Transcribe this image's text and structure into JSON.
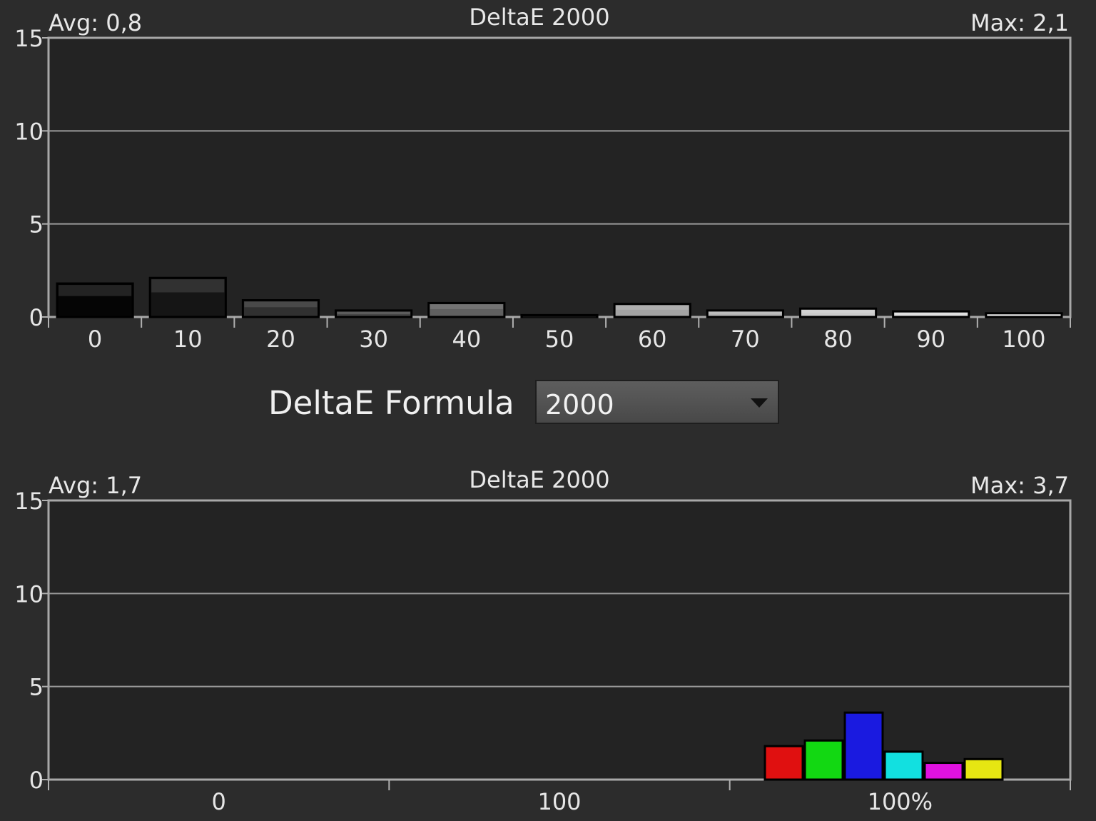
{
  "charts": [
    {
      "avg_label": "Avg: 0,8",
      "title": "DeltaE 2000",
      "max_label": "Max: 2,1"
    },
    {
      "avg_label": "Avg: 1,7",
      "title": "DeltaE 2000",
      "max_label": "Max: 3,7"
    }
  ],
  "formula": {
    "label": "DeltaE Formula",
    "value": "2000"
  },
  "colors": {
    "background": "#2c2c2c",
    "plot_area": "#232323",
    "grid": "#9a9a9a"
  },
  "chart_data": [
    {
      "type": "bar",
      "title": "DeltaE 2000",
      "ylim": [
        0,
        15
      ],
      "yticks": [
        "0",
        "5",
        "10",
        "15"
      ],
      "grid": true,
      "categories": [
        "0",
        "10",
        "20",
        "30",
        "40",
        "50",
        "60",
        "70",
        "80",
        "90",
        "100"
      ],
      "values": [
        1.8,
        2.1,
        0.9,
        0.35,
        0.75,
        0.1,
        0.7,
        0.35,
        0.45,
        0.3,
        0.2
      ],
      "bar_colors": [
        "#050505",
        "#151515",
        "#303030",
        "#474747",
        "#606060",
        "#777777",
        "#a3a3a3",
        "#b4b4b4",
        "#cccccc",
        "#dcdcdc",
        "#ededed"
      ]
    },
    {
      "type": "bar",
      "title": "DeltaE 2000",
      "ylim": [
        0,
        15
      ],
      "yticks": [
        "0",
        "5",
        "10",
        "15"
      ],
      "grid": true,
      "xtick_labels": [
        "0",
        "100",
        "100%"
      ],
      "categories": [
        "red",
        "green",
        "blue",
        "cyan",
        "magenta",
        "yellow"
      ],
      "values": [
        1.8,
        2.1,
        3.6,
        1.5,
        0.9,
        1.1
      ],
      "bar_colors": [
        "#e01010",
        "#12d812",
        "#1a1ae0",
        "#12e0e0",
        "#e012e0",
        "#e6e612"
      ]
    }
  ]
}
